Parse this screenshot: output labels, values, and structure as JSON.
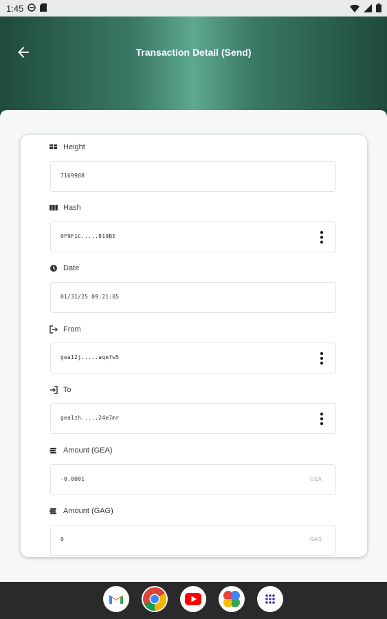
{
  "status_bar": {
    "time": "1:45"
  },
  "header": {
    "title": "Transaction Detail (Send)"
  },
  "fields": [
    {
      "label": "Height",
      "value": "7169988",
      "icon": "height-icon"
    },
    {
      "label": "Hash",
      "value": "0F9F1C.....819BE",
      "icon": "hash-icon",
      "has_menu": true
    },
    {
      "label": "Date",
      "value": "01/31/25 09:21:05",
      "icon": "clock-icon"
    },
    {
      "label": "From",
      "value": "gea12j.....aqefw5",
      "icon": "from-icon",
      "has_menu": true
    },
    {
      "label": "To",
      "value": "gea1zh.....24e7mr",
      "icon": "to-icon",
      "has_menu": true
    },
    {
      "label": "Amount (GEA)",
      "value": "-0.0001",
      "suffix": "GEA",
      "icon": "coins-icon"
    },
    {
      "label": "Amount (GAG)",
      "value": "0",
      "suffix": "GAG",
      "icon": "coins-icon"
    }
  ],
  "dock": [
    "gmail-icon",
    "chrome-icon",
    "youtube-icon",
    "photos-icon",
    "app-drawer-icon"
  ],
  "colors": {
    "header_dark": "#1f4a3c",
    "header_light": "#5ea891",
    "nav_bar": "#2a2a2a"
  }
}
